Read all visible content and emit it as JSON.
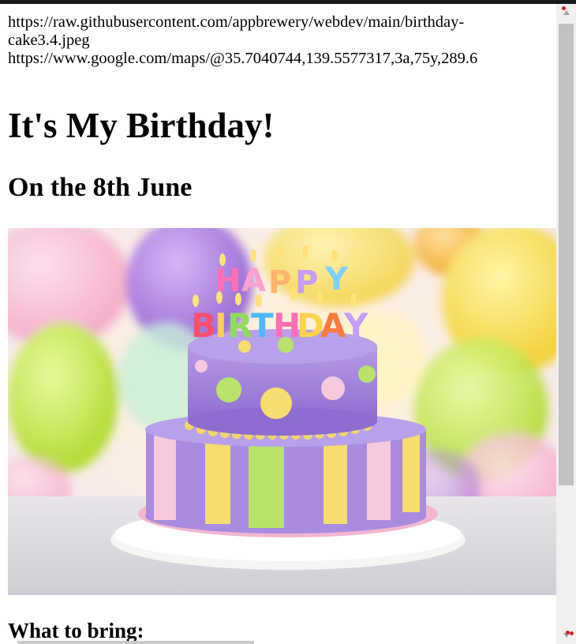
{
  "urls": [
    "https://raw.githubusercontent.com/appbrewery/webdev/main/birthday-",
    "cake3.4.jpeg",
    "https://www.google.com/maps/@35.7040744,139.5577317,3a,75y,289.6"
  ],
  "heading": "It's My Birthday!",
  "date_heading": "On the 8th June",
  "image": {
    "description_icon": "birthday-cake-image",
    "candles_text": [
      "HAPPY",
      "BIRTHDAY"
    ]
  },
  "what_to_bring": "What to bring:",
  "colors": {
    "top_bar": "#1a1a1a",
    "scroll_thumb": "#c1c1c1",
    "scroll_track": "#f0f0f0"
  }
}
